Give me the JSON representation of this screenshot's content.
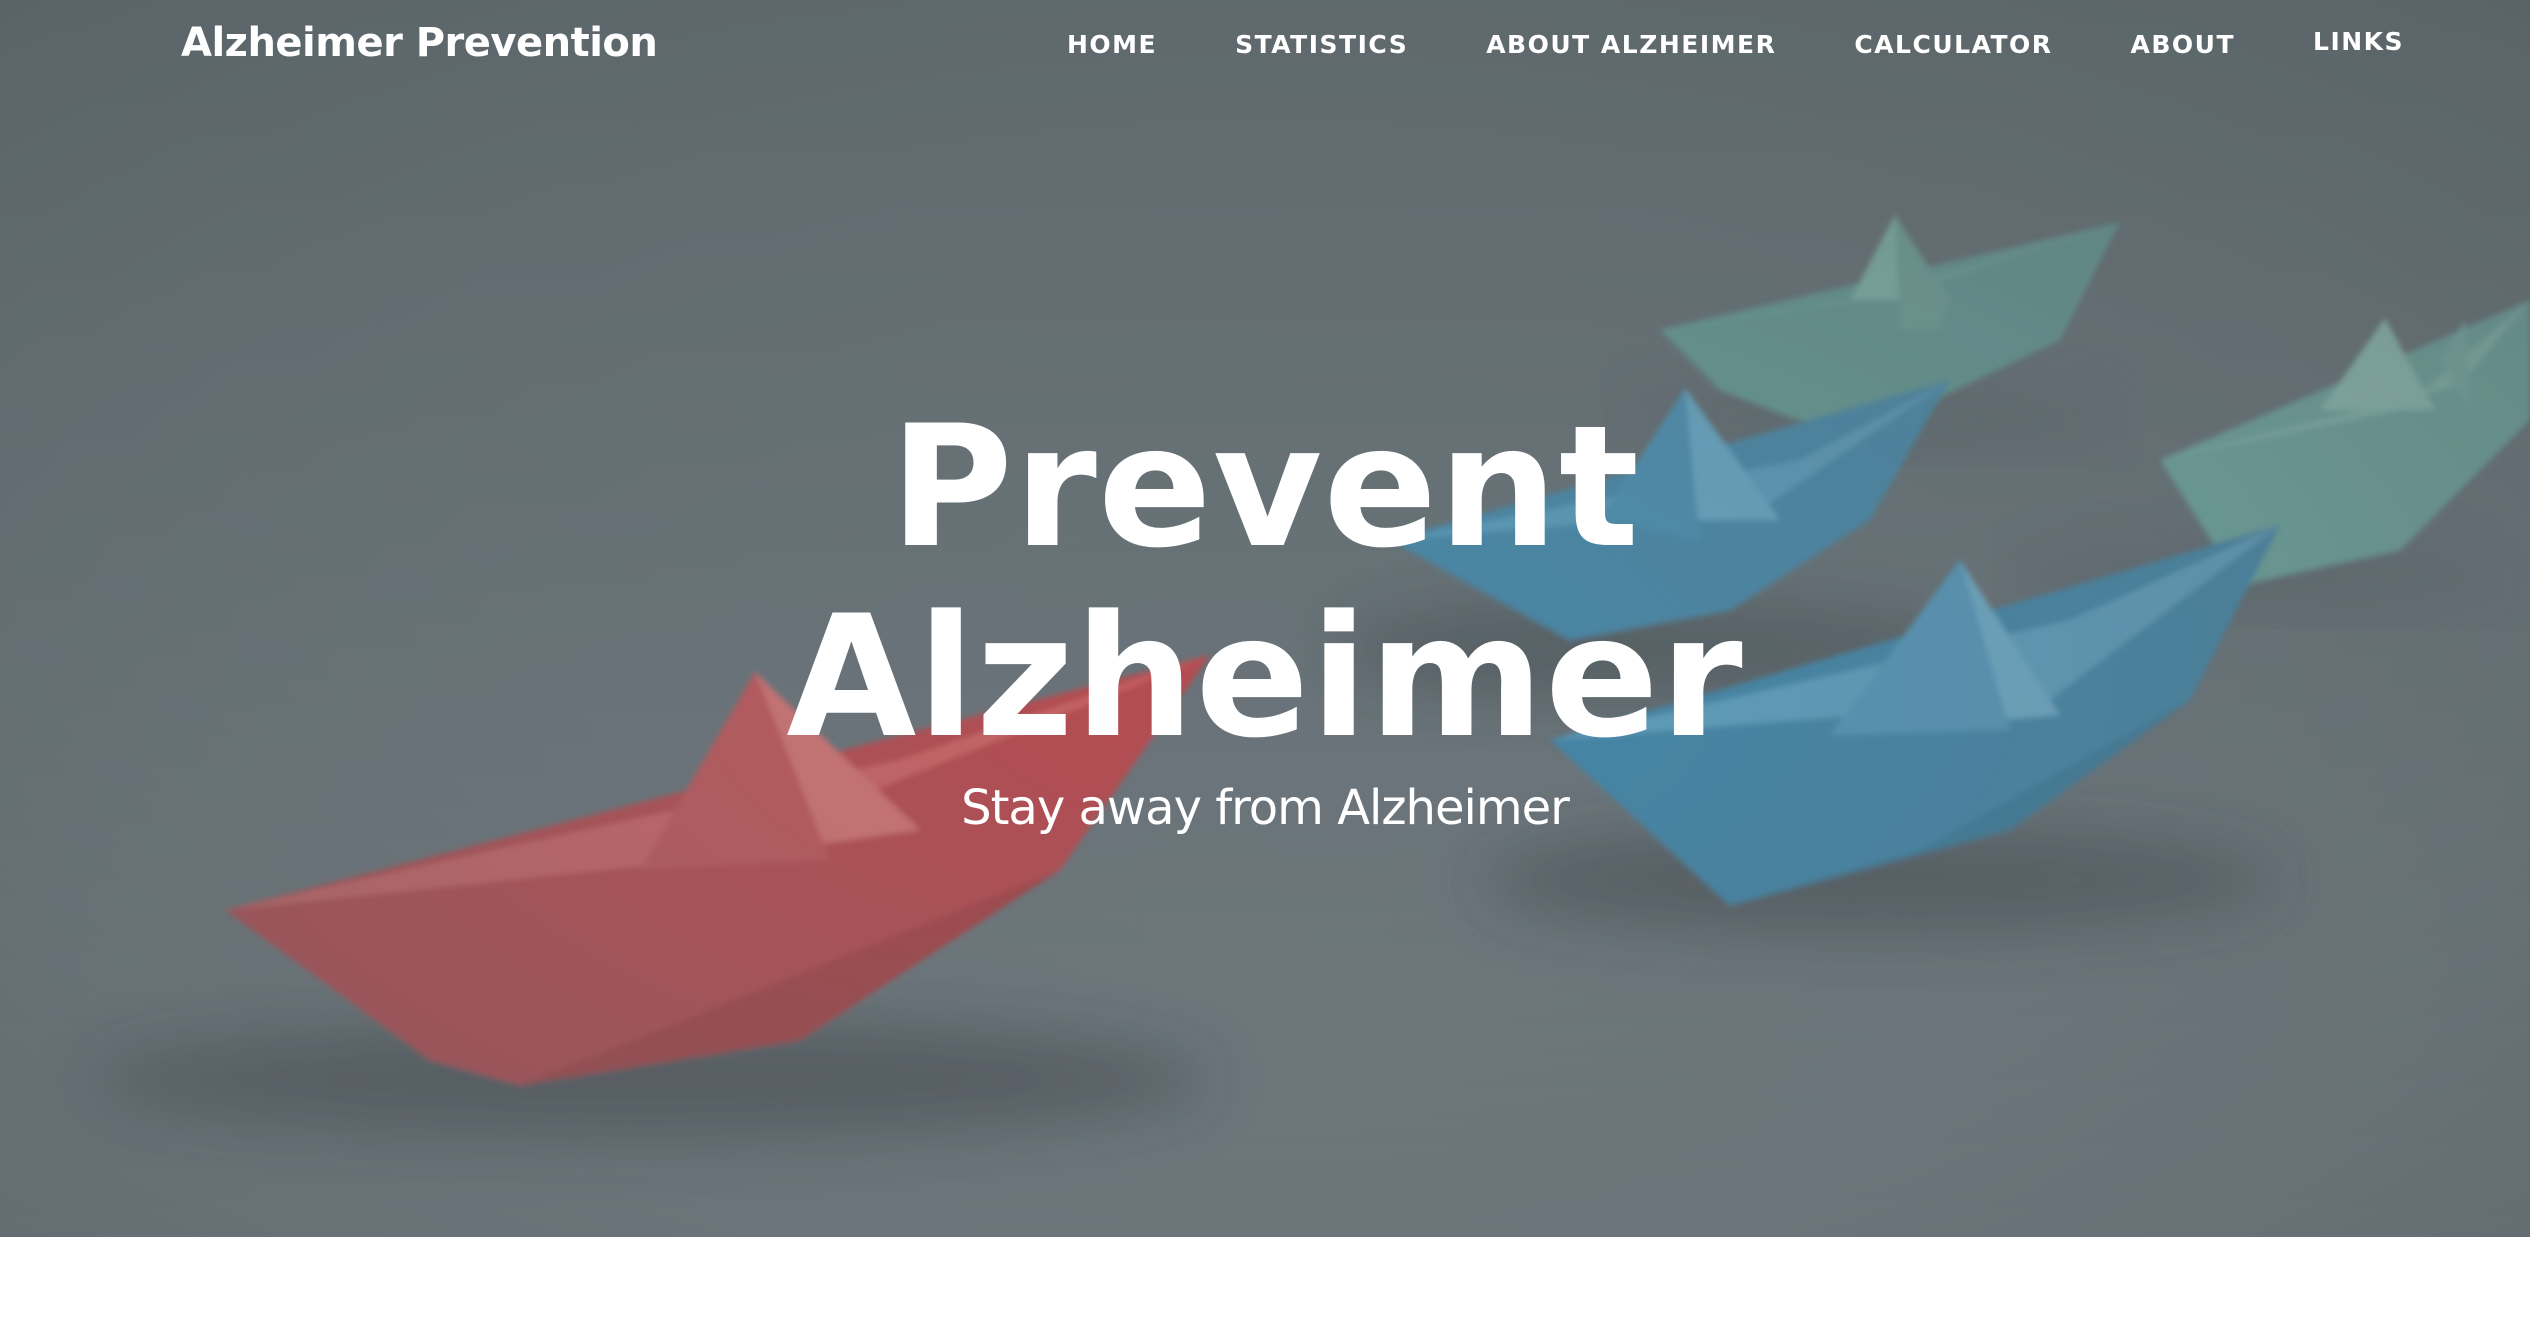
{
  "brand": {
    "title": "Alzheimer Prevention"
  },
  "nav": {
    "items": [
      {
        "label": "HOME"
      },
      {
        "label": "STATISTICS"
      },
      {
        "label": "ABOUT ALZHEIMER"
      },
      {
        "label": "CALCULATOR"
      },
      {
        "label": "ABOUT"
      },
      {
        "label": "LINKS"
      }
    ]
  },
  "hero": {
    "title_line1": "Prevent",
    "title_line2": "Alzheimer",
    "subtitle": "Stay away from Alzheimer",
    "background_image": "origami-paper-boats",
    "colors": {
      "background": "#6f7a80",
      "red_boat": "#d9595d",
      "blue_boat": "#4fa3c8",
      "teal_boat": "#72c2b4",
      "text": "#ffffff"
    }
  }
}
